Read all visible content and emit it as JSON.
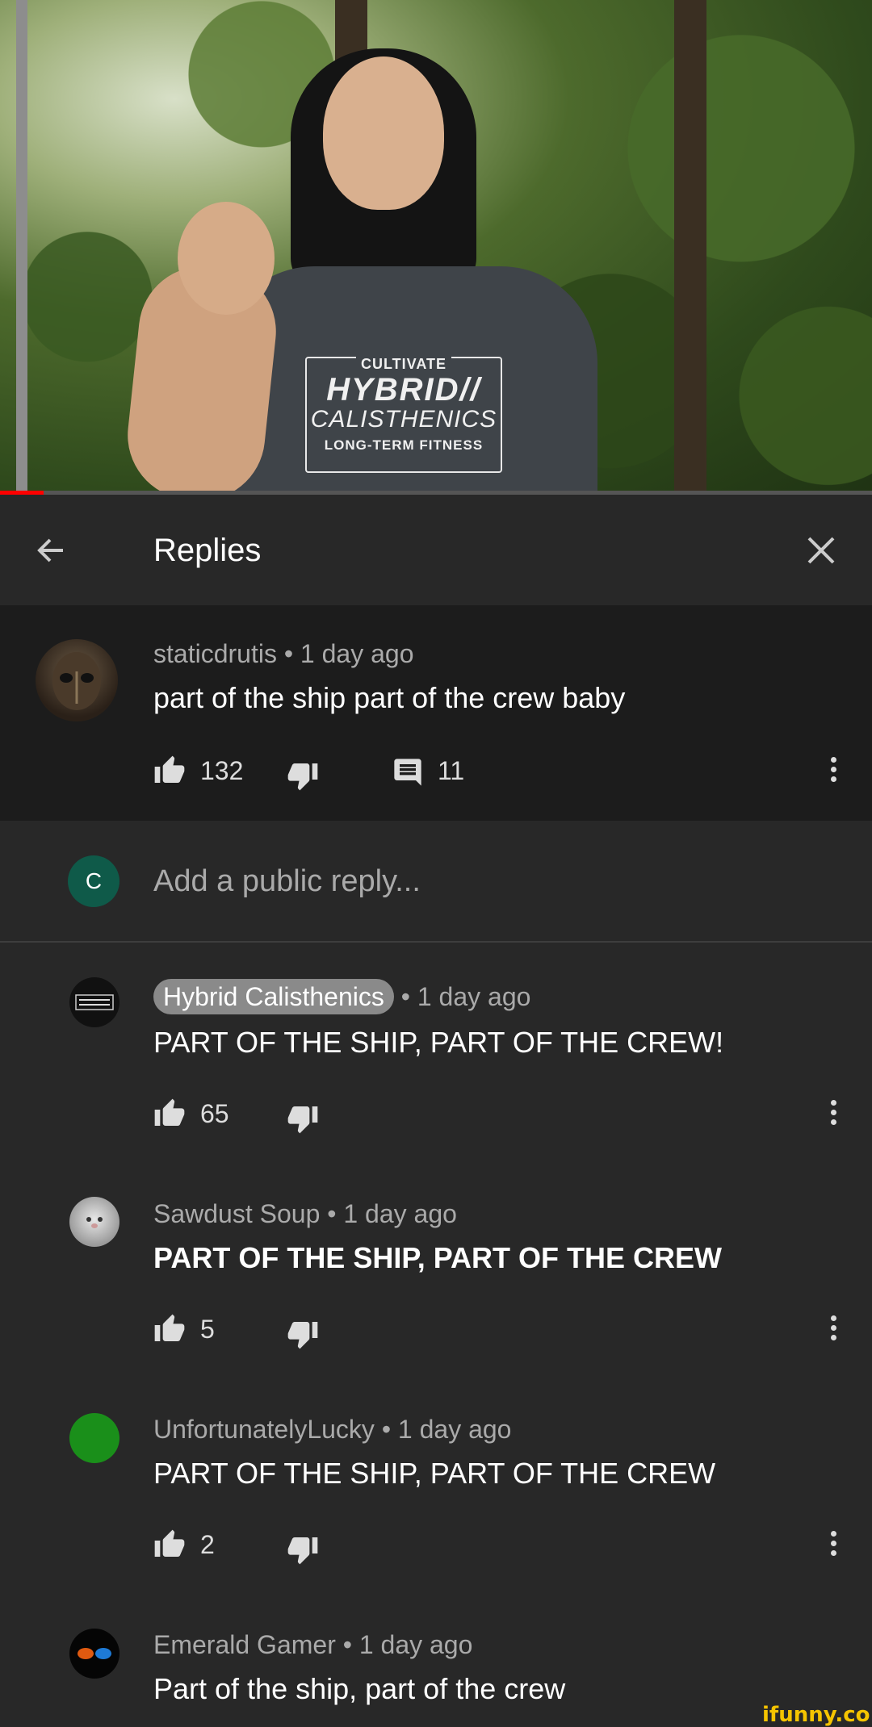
{
  "header": {
    "title": "Replies"
  },
  "parent_comment": {
    "author": "staticdrutis",
    "time": "1 day ago",
    "text": "part of the ship part of the crew baby",
    "likes": "132",
    "replies": "11"
  },
  "add_reply": {
    "avatar_letter": "C",
    "placeholder": "Add a public reply..."
  },
  "replies": [
    {
      "author": "Hybrid Calisthenics",
      "time": "1 day ago",
      "text": "PART OF THE SHIP, PART OF THE CREW!",
      "likes": "65",
      "avatar": "hybrid-logo"
    },
    {
      "author": "Sawdust Soup",
      "time": "1 day ago",
      "text": "PART OF THE SHIP, PART OF THE CREW",
      "likes": "5",
      "avatar": "photo"
    },
    {
      "author": "UnfortunatelyLucky",
      "time": "1 day ago",
      "text": "PART OF THE SHIP, PART OF THE CREW",
      "likes": "2",
      "avatar": "green"
    },
    {
      "author": "Emerald Gamer",
      "time": "1 day ago",
      "text": "Part of the ship, part of the crew",
      "avatar": "flames"
    }
  ],
  "video": {
    "shirt_line1": "CULTIVATE",
    "shirt_line2": "HYBRID//",
    "shirt_line3": "CALISTHENICS",
    "shirt_line4": "LONG-TERM FITNESS",
    "progress": 0.05
  },
  "watermark": "ifunny.co",
  "colors": {
    "background": "#282828",
    "parent_bg": "#1c1c1c",
    "progress": "#ff0000",
    "badge": "#8a8a8a"
  }
}
